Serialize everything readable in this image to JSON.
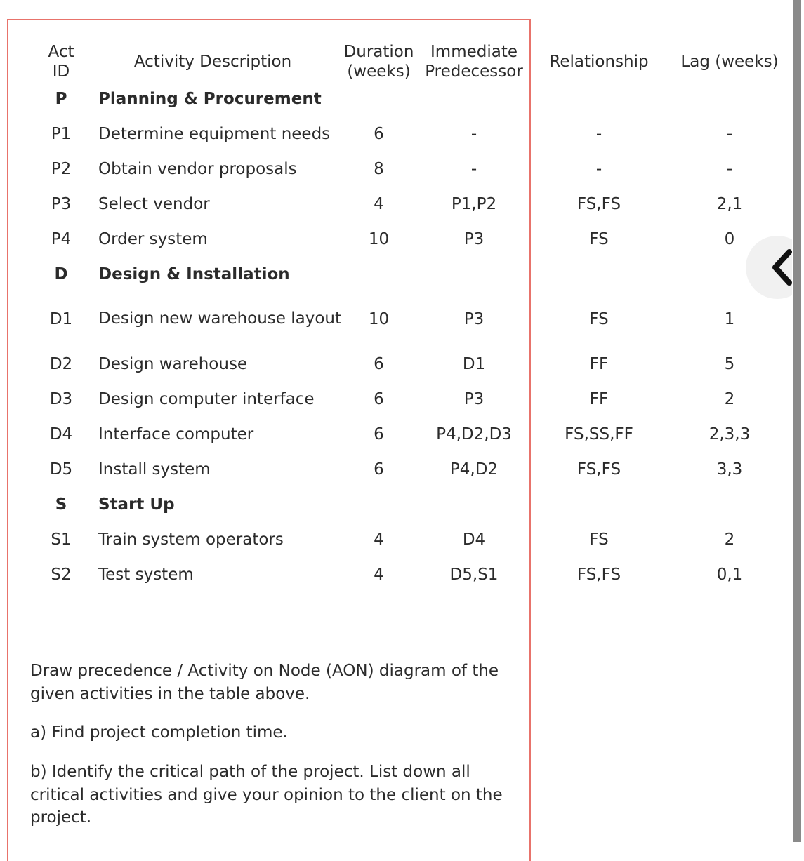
{
  "table": {
    "headers": {
      "act_id_line1": "Act",
      "act_id_line2": "ID",
      "description": "Activity Description",
      "duration_line1": "Duration",
      "duration_line2": "(weeks)",
      "predecessor_line1": "Immediate",
      "predecessor_line2": "Predecessor",
      "relationship": "Relationship",
      "lag": "Lag (weeks)"
    },
    "rows": [
      {
        "type": "group",
        "id": "P",
        "description": "Planning & Procurement",
        "duration": "",
        "predecessor": "",
        "relationship": "",
        "lag": ""
      },
      {
        "type": "item",
        "id": "P1",
        "description": "Determine equipment needs",
        "duration": "6",
        "predecessor": "-",
        "relationship": "-",
        "lag": "-"
      },
      {
        "type": "item",
        "id": "P2",
        "description": "Obtain vendor proposals",
        "duration": "8",
        "predecessor": "-",
        "relationship": "-",
        "lag": "-"
      },
      {
        "type": "item",
        "id": "P3",
        "description": "Select vendor",
        "duration": "4",
        "predecessor": "P1,P2",
        "relationship": "FS,FS",
        "lag": "2,1"
      },
      {
        "type": "item",
        "id": "P4",
        "description": "Order system",
        "duration": "10",
        "predecessor": "P3",
        "relationship": "FS",
        "lag": "0"
      },
      {
        "type": "group",
        "id": "D",
        "description": "Design & Installation",
        "duration": "",
        "predecessor": "",
        "relationship": "",
        "lag": ""
      },
      {
        "type": "tall",
        "id": "D1",
        "description": "Design new warehouse layout",
        "duration": "10",
        "predecessor": "P3",
        "relationship": "FS",
        "lag": "1"
      },
      {
        "type": "item",
        "id": "D2",
        "description": "Design warehouse",
        "duration": "6",
        "predecessor": "D1",
        "relationship": "FF",
        "lag": "5"
      },
      {
        "type": "item",
        "id": "D3",
        "description": "Design computer interface",
        "duration": "6",
        "predecessor": "P3",
        "relationship": "FF",
        "lag": "2"
      },
      {
        "type": "item",
        "id": "D4",
        "description": "Interface computer",
        "duration": "6",
        "predecessor": "P4,D2,D3",
        "relationship": "FS,SS,FF",
        "lag": "2,3,3"
      },
      {
        "type": "item",
        "id": "D5",
        "description": "Install system",
        "duration": "6",
        "predecessor": "P4,D2",
        "relationship": "FS,FS",
        "lag": "3,3"
      },
      {
        "type": "group",
        "id": "S",
        "description": "Start Up",
        "duration": "",
        "predecessor": "",
        "relationship": "",
        "lag": ""
      },
      {
        "type": "item",
        "id": "S1",
        "description": "Train system operators",
        "duration": "4",
        "predecessor": "D4",
        "relationship": "FS",
        "lag": "2"
      },
      {
        "type": "item",
        "id": "S2",
        "description": "Test system",
        "duration": "4",
        "predecessor": "D5,S1",
        "relationship": "FS,FS",
        "lag": "0,1"
      }
    ]
  },
  "questions": {
    "intro": "Draw precedence / Activity on Node (AON) diagram of the given activities in the table above.",
    "part_a": "a) Find project completion time.",
    "part_b": "b) Identify the critical path of the project. List down all critical activities and give your opinion to the client on the project."
  },
  "controls": {
    "prev_icon": "chevron-left-icon"
  },
  "colors": {
    "annotation_border": "#e8736b",
    "text": "#2b2b2b",
    "scrollbar": "#8a8a8a"
  }
}
